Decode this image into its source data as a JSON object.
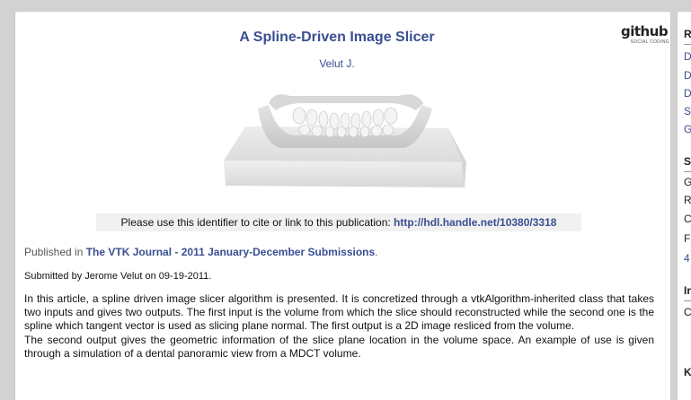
{
  "article": {
    "title": "A Spline-Driven Image Slicer",
    "author": "Velut J.",
    "cite_text": "Please use this identifier to cite or link to this publication: ",
    "cite_link": "http://hdl.handle.net/10380/3318",
    "published_prefix": "Published in ",
    "journal_link": "The VTK Journal - 2011 January-December Submissions",
    "published_suffix": ".",
    "submitted": "Submitted by Jerome Velut on 09-19-2011.",
    "abstract_1": "In this article, a spline driven image slicer algorithm is presented. It is concretized through a vtkAlgorithm-inherited class that takes two inputs and gives two outputs. The first input is the volume from which the slice should reconstructed while the second one is the spline which tangent vector is used as slicing plane normal. The first output is a 2D image resliced from the volume.",
    "abstract_2": "The second output gives the geometric information of the slice plane location in the volume space. An example of use is given through a simulation of a dental panoramic view from a MDCT volume."
  },
  "github": {
    "word": "github",
    "tagline": "SOCIAL CODING"
  },
  "sidebar": {
    "heading_1": "R",
    "links_1": [
      "D",
      "D",
      "D",
      "S",
      "G"
    ],
    "heading_2": "S",
    "items_2": [
      "G",
      "R",
      "C",
      "F"
    ],
    "link_2": "4",
    "heading_3": "Ir",
    "item_3": "C",
    "heading_4": "K"
  }
}
